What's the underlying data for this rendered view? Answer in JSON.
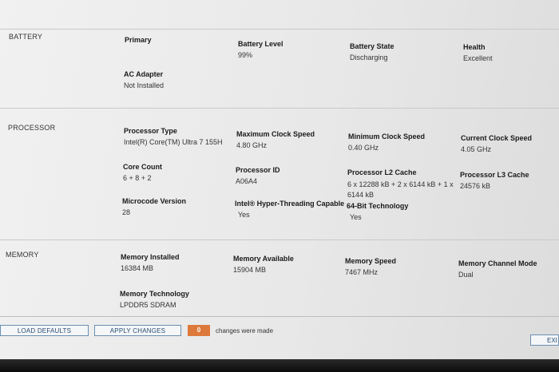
{
  "sections": {
    "battery": {
      "label": "BATTERY",
      "primary_label": "Primary",
      "battery_level": {
        "key": "Battery Level",
        "value": "99%"
      },
      "battery_state": {
        "key": "Battery State",
        "value": "Discharging"
      },
      "health": {
        "key": "Health",
        "value": "Excellent"
      },
      "ac_adapter": {
        "key": "AC Adapter",
        "value": "Not Installed"
      }
    },
    "processor": {
      "label": "PROCESSOR",
      "processor_type": {
        "key": "Processor Type",
        "value": "Intel(R) Core(TM) Ultra 7 155H"
      },
      "max_clock": {
        "key": "Maximum Clock Speed",
        "value": "4.80 GHz"
      },
      "min_clock": {
        "key": "Minimum Clock Speed",
        "value": "0.40 GHz"
      },
      "current_clock": {
        "key": "Current Clock Speed",
        "value": "4.05 GHz"
      },
      "core_count": {
        "key": "Core Count",
        "value": "6 + 8 + 2"
      },
      "processor_id": {
        "key": "Processor ID",
        "value": "A06A4"
      },
      "l2_cache": {
        "key": "Processor L2 Cache",
        "value": "6 x 12288  kB + 2 x 6144  kB + 1 x 6144 kB"
      },
      "l3_cache": {
        "key": "Processor L3 Cache",
        "value": "24576 kB"
      },
      "microcode": {
        "key": "Microcode Version",
        "value": "28"
      },
      "hyperthreading": {
        "key": "Intel® Hyper-Threading Capable",
        "value": "Yes"
      },
      "bit64": {
        "key": "64-Bit Technology",
        "value": "Yes"
      }
    },
    "memory": {
      "label": "MEMORY",
      "installed": {
        "key": "Memory Installed",
        "value": "16384 MB"
      },
      "available": {
        "key": "Memory Available",
        "value": "15904 MB"
      },
      "speed": {
        "key": "Memory Speed",
        "value": "7467 MHz"
      },
      "channel_mode": {
        "key": "Memory Channel Mode",
        "value": "Dual"
      },
      "technology": {
        "key": "Memory Technology",
        "value": "LPDDR5 SDRAM"
      }
    }
  },
  "footer": {
    "load_defaults": "LOAD DEFAULTS",
    "apply_changes": "APPLY CHANGES",
    "changes_count": "0",
    "changes_text": "changes were made",
    "exit": "EXI"
  }
}
